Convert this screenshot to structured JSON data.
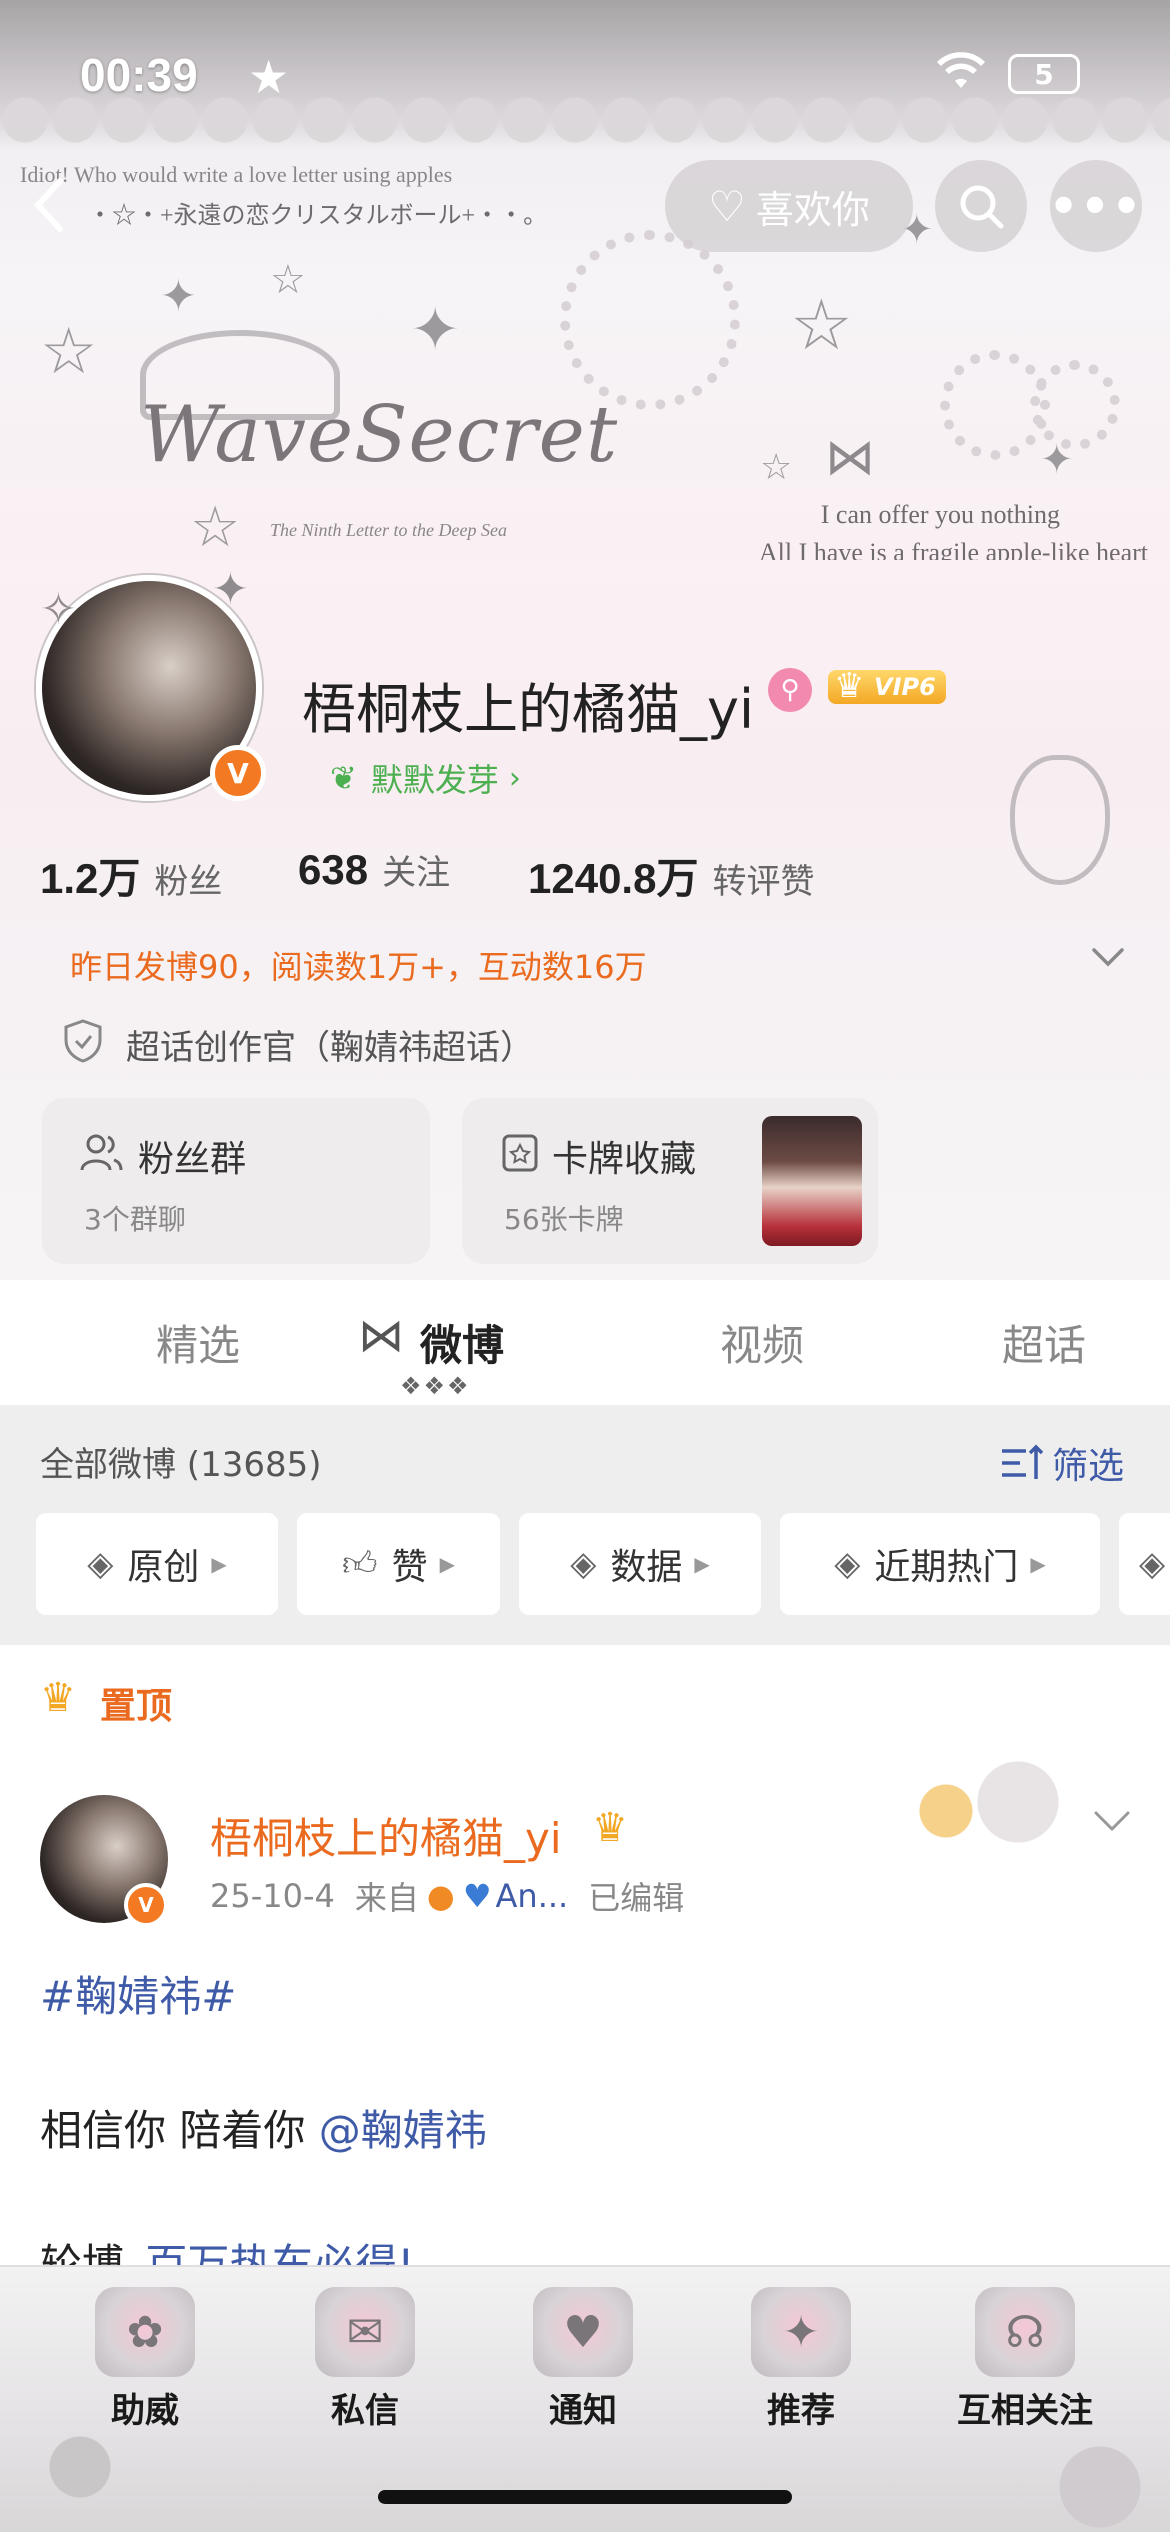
{
  "status_bar": {
    "time": "00:39",
    "battery": "5"
  },
  "nav": {
    "back_icon": "chevron-left-icon",
    "like_label": "喜欢你",
    "search_icon": "search-icon",
    "more_icon": "ellipsis-icon"
  },
  "banner": {
    "title": "WaveSecret",
    "subtitle": "The Ninth Letter to the Deep Sea",
    "top_line": "Idiot! Who would write a love letter using apples",
    "jp_line": "・☆・+永遠の恋クリスタルボール+・・。",
    "quote_1": "I can offer you nothing",
    "quote_2": "All I have is a fragile apple-like heart"
  },
  "profile": {
    "username": "梧桐枝上的橘猫_yi",
    "vip": "VIP6",
    "sprout_text": "默默发芽",
    "stats": [
      {
        "num": "1.2万",
        "label": "粉丝"
      },
      {
        "num": "638",
        "label": "关注"
      },
      {
        "num": "1240.8万",
        "label": "转评赞"
      }
    ],
    "summary": "昨日发博90，阅读数1万+，互动数16万",
    "cert": "超话创作官（鞠婧祎超话）",
    "cards": [
      {
        "title": "粉丝群",
        "sub": "3个群聊"
      },
      {
        "title": "卡牌收藏",
        "sub": "56张卡牌"
      }
    ]
  },
  "tabs": [
    "精选",
    "微博",
    "视频",
    "超话"
  ],
  "filter": {
    "all_label": "全部微博 (13685)",
    "filter_label": "筛选",
    "chips": [
      "原创",
      "赞",
      "数据",
      "近期热门"
    ]
  },
  "feed": {
    "pin_label": "置顶",
    "post": {
      "user": "梧桐枝上的橘猫_yi",
      "date": "25-10-4",
      "from_label": "来自",
      "source": "An...",
      "edited": "已编辑",
      "topic": "#鞠婧祎#",
      "text": "相信你 陪着你",
      "mention": "@鞠婧祎",
      "third_line_prefix": "轮博",
      "third_line_link": "百万热车必得!"
    }
  },
  "bottom_bar": [
    "助威",
    "私信",
    "通知",
    "推荐",
    "互相关注"
  ],
  "colors": {
    "accent_orange": "#ea6b1f",
    "link_blue": "#3f5ba8",
    "vip_gold": "#f3a825",
    "verified_orange": "#f37a23"
  }
}
